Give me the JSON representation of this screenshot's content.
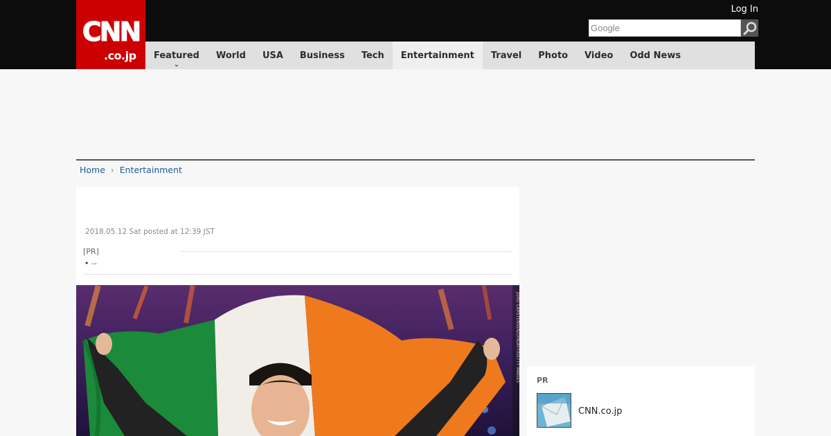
{
  "header": {
    "logo_main": "CNN",
    "logo_sub": ".co.jp",
    "login_label": "Log In",
    "search_placeholder": "Google",
    "search_icon": "magnifier-icon",
    "brand_color": "#cc0000"
  },
  "nav": {
    "items": [
      {
        "label": "Featured"
      },
      {
        "label": "World"
      },
      {
        "label": "USA"
      },
      {
        "label": "Business"
      },
      {
        "label": "Tech"
      },
      {
        "label": "Entertainment"
      },
      {
        "label": "Travel"
      },
      {
        "label": "Photo"
      },
      {
        "label": "Video"
      },
      {
        "label": "Odd News"
      }
    ],
    "active": "Entertainment"
  },
  "breadcrumb": {
    "home": "Home",
    "section": "Entertainment"
  },
  "article": {
    "date": "2018.05.12 Sat posted at 12:39 JST",
    "pr_label": "[PR]",
    "pr_link": "--",
    "photo_credit": "JORG CARSTENSEN/DPA/AFP/GETTY IMAGES"
  },
  "sidebar_pr": {
    "title": "PR",
    "name": "CNN.co.jp"
  }
}
